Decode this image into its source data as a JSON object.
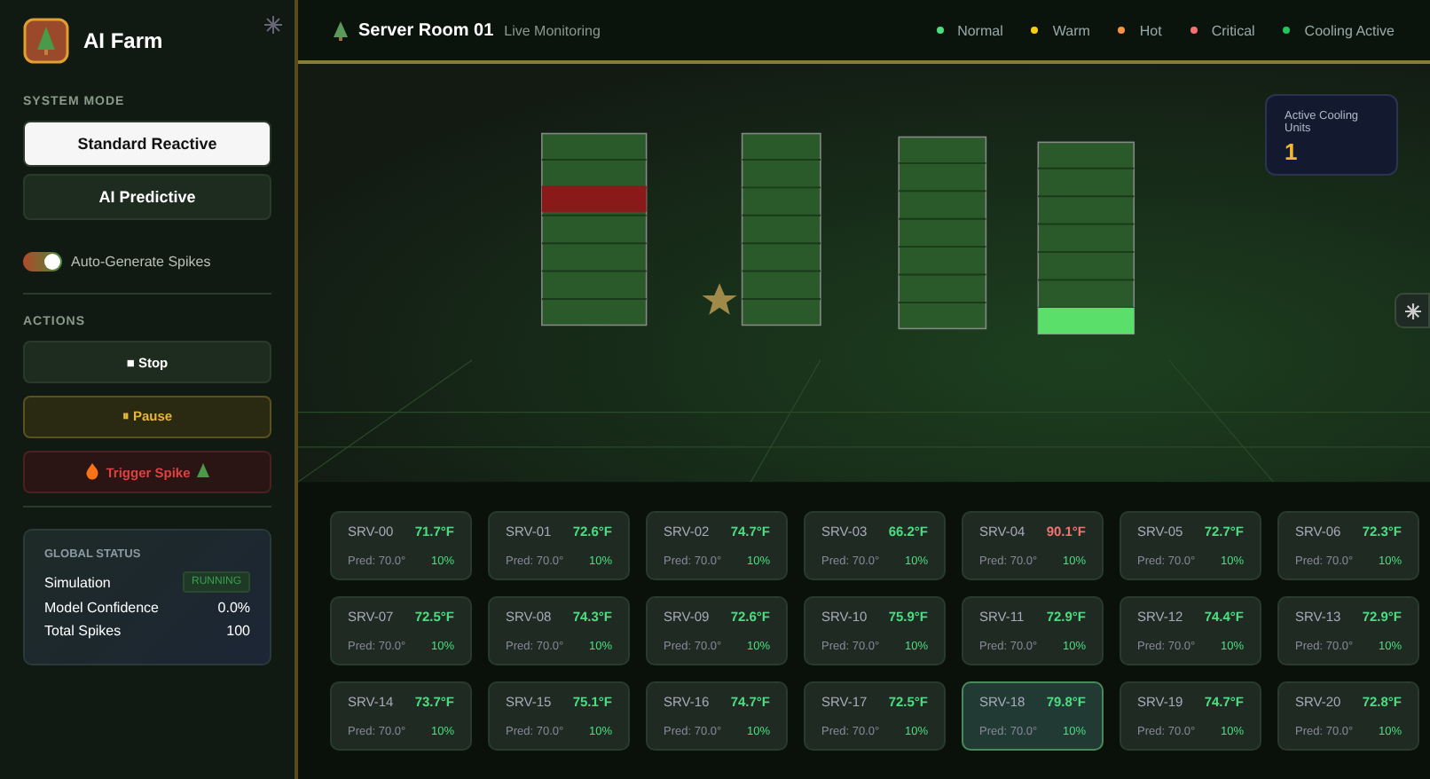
{
  "sidebar": {
    "app_title": "AI Farm",
    "system_mode_label": "SYSTEM MODE",
    "modes": [
      {
        "label": "Standard Reactive",
        "selected": true
      },
      {
        "label": "AI Predictive",
        "selected": false
      }
    ],
    "auto_spikes": {
      "label": "Auto-Generate Spikes",
      "on": true
    },
    "actions_label": "ACTIONS",
    "actions": [
      {
        "kind": "stop",
        "icon": "■",
        "label": "Stop"
      },
      {
        "kind": "pause",
        "icon": "⏸",
        "label": "Pause"
      },
      {
        "kind": "trigger",
        "label": "Trigger Spike"
      }
    ],
    "global_status": {
      "title": "GLOBAL STATUS",
      "simulation_label": "Simulation",
      "simulation_value": "RUNNING",
      "confidence_label": "Model Confidence",
      "confidence_value": "0.0%",
      "spikes_label": "Total Spikes",
      "spikes_value": "100"
    }
  },
  "header": {
    "title": "Server Room 01",
    "subtitle": "Live Monitoring",
    "legend": [
      {
        "label": "Normal",
        "color": "#4ade80"
      },
      {
        "label": "Warm",
        "color": "#facc15"
      },
      {
        "label": "Hot",
        "color": "#fb923c"
      },
      {
        "label": "Critical",
        "color": "#f87171"
      },
      {
        "label": "Cooling Active",
        "color": "#22c55e"
      }
    ]
  },
  "cooling": {
    "label": "Active Cooling Units",
    "value": "1"
  },
  "servers": [
    {
      "id": "SRV-00",
      "temp": "71.7°F",
      "pred": "Pred: 70.0°",
      "pct": "10%",
      "color": "#4ade80",
      "selected": false
    },
    {
      "id": "SRV-01",
      "temp": "72.6°F",
      "pred": "Pred: 70.0°",
      "pct": "10%",
      "color": "#4ade80",
      "selected": false
    },
    {
      "id": "SRV-02",
      "temp": "74.7°F",
      "pred": "Pred: 70.0°",
      "pct": "10%",
      "color": "#4ade80",
      "selected": false
    },
    {
      "id": "SRV-03",
      "temp": "66.2°F",
      "pred": "Pred: 70.0°",
      "pct": "10%",
      "color": "#4ade80",
      "selected": false
    },
    {
      "id": "SRV-04",
      "temp": "90.1°F",
      "pred": "Pred: 70.0°",
      "pct": "10%",
      "color": "#f87171",
      "selected": false
    },
    {
      "id": "SRV-05",
      "temp": "72.7°F",
      "pred": "Pred: 70.0°",
      "pct": "10%",
      "color": "#4ade80",
      "selected": false
    },
    {
      "id": "SRV-06",
      "temp": "72.3°F",
      "pred": "Pred: 70.0°",
      "pct": "10%",
      "color": "#4ade80",
      "selected": false
    },
    {
      "id": "SRV-07",
      "temp": "72.5°F",
      "pred": "Pred: 70.0°",
      "pct": "10%",
      "color": "#4ade80",
      "selected": false
    },
    {
      "id": "SRV-08",
      "temp": "74.3°F",
      "pred": "Pred: 70.0°",
      "pct": "10%",
      "color": "#4ade80",
      "selected": false
    },
    {
      "id": "SRV-09",
      "temp": "72.6°F",
      "pred": "Pred: 70.0°",
      "pct": "10%",
      "color": "#4ade80",
      "selected": false
    },
    {
      "id": "SRV-10",
      "temp": "75.9°F",
      "pred": "Pred: 70.0°",
      "pct": "10%",
      "color": "#4ade80",
      "selected": false
    },
    {
      "id": "SRV-11",
      "temp": "72.9°F",
      "pred": "Pred: 70.0°",
      "pct": "10%",
      "color": "#4ade80",
      "selected": false
    },
    {
      "id": "SRV-12",
      "temp": "74.4°F",
      "pred": "Pred: 70.0°",
      "pct": "10%",
      "color": "#4ade80",
      "selected": false
    },
    {
      "id": "SRV-13",
      "temp": "72.9°F",
      "pred": "Pred: 70.0°",
      "pct": "10%",
      "color": "#4ade80",
      "selected": false
    },
    {
      "id": "SRV-14",
      "temp": "73.7°F",
      "pred": "Pred: 70.0°",
      "pct": "10%",
      "color": "#4ade80",
      "selected": false
    },
    {
      "id": "SRV-15",
      "temp": "75.1°F",
      "pred": "Pred: 70.0°",
      "pct": "10%",
      "color": "#4ade80",
      "selected": false
    },
    {
      "id": "SRV-16",
      "temp": "74.7°F",
      "pred": "Pred: 70.0°",
      "pct": "10%",
      "color": "#4ade80",
      "selected": false
    },
    {
      "id": "SRV-17",
      "temp": "72.5°F",
      "pred": "Pred: 70.0°",
      "pct": "10%",
      "color": "#4ade80",
      "selected": false
    },
    {
      "id": "SRV-18",
      "temp": "79.8°F",
      "pred": "Pred: 70.0°",
      "pct": "10%",
      "color": "#4ade80",
      "selected": true
    },
    {
      "id": "SRV-19",
      "temp": "74.7°F",
      "pred": "Pred: 70.0°",
      "pct": "10%",
      "color": "#4ade80",
      "selected": false
    },
    {
      "id": "SRV-20",
      "temp": "72.8°F",
      "pred": "Pred: 70.0°",
      "pct": "10%",
      "color": "#4ade80",
      "selected": false
    }
  ]
}
